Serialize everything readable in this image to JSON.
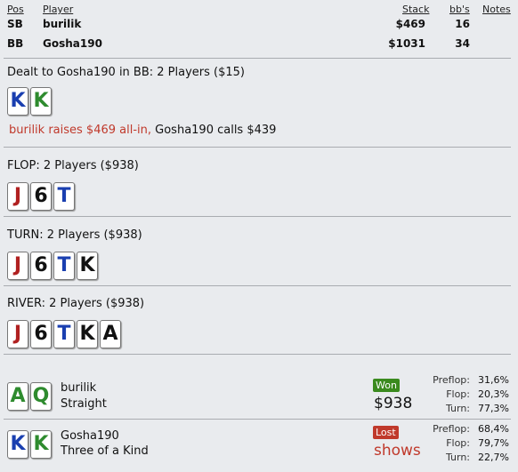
{
  "header": {
    "cols": {
      "pos": "Pos",
      "player": "Player",
      "stack": "Stack",
      "bbs": "bb's",
      "notes": "Notes"
    },
    "rows": [
      {
        "pos": "SB",
        "player": "burilik",
        "stack": "$469",
        "bbs": "16"
      },
      {
        "pos": "BB",
        "player": "Gosha190",
        "stack": "$1031",
        "bbs": "34"
      }
    ]
  },
  "preflop": {
    "title": "Dealt to Gosha190 in BB: 2 Players ($15)",
    "cards": [
      {
        "rank": "K",
        "color": "#1a3fb0"
      },
      {
        "rank": "K",
        "color": "#2e8b2e"
      }
    ],
    "action_red": "burilik raises $469 all-in,",
    "action_black": " Gosha190 calls $439"
  },
  "flop": {
    "title": "FLOP: 2 Players ($938)",
    "cards": [
      {
        "rank": "J",
        "color": "#b02020"
      },
      {
        "rank": "6",
        "color": "#111111"
      },
      {
        "rank": "T",
        "color": "#1a3fb0"
      }
    ]
  },
  "turn": {
    "title": "TURN: 2 Players ($938)",
    "cards": [
      {
        "rank": "J",
        "color": "#b02020"
      },
      {
        "rank": "6",
        "color": "#111111"
      },
      {
        "rank": "T",
        "color": "#1a3fb0"
      },
      {
        "rank": "K",
        "color": "#111111"
      }
    ]
  },
  "river": {
    "title": "RIVER: 2 Players ($938)",
    "cards": [
      {
        "rank": "J",
        "color": "#b02020"
      },
      {
        "rank": "6",
        "color": "#111111"
      },
      {
        "rank": "T",
        "color": "#1a3fb0"
      },
      {
        "rank": "K",
        "color": "#111111"
      },
      {
        "rank": "A",
        "color": "#111111"
      }
    ]
  },
  "results": [
    {
      "name": "burilik",
      "hand": "Straight",
      "cards": [
        {
          "rank": "A",
          "color": "#2e8b2e"
        },
        {
          "rank": "Q",
          "color": "#2e8b2e"
        }
      ],
      "badge": "Won",
      "badge_color": "#3a8a1e",
      "amount": "$938",
      "amount_color": "#111111",
      "stats": [
        {
          "label": "Preflop:",
          "value": "31,6%"
        },
        {
          "label": "Flop:",
          "value": "20,3%"
        },
        {
          "label": "Turn:",
          "value": "77,3%"
        }
      ]
    },
    {
      "name": "Gosha190",
      "hand": "Three of a Kind",
      "cards": [
        {
          "rank": "K",
          "color": "#1a3fb0"
        },
        {
          "rank": "K",
          "color": "#2e8b2e"
        }
      ],
      "badge": "Lost",
      "badge_color": "#c0392b",
      "amount": "shows",
      "amount_color": "#c0392b",
      "stats": [
        {
          "label": "Preflop:",
          "value": "68,4%"
        },
        {
          "label": "Flop:",
          "value": "79,7%"
        },
        {
          "label": "Turn:",
          "value": "22,7%"
        }
      ]
    }
  ]
}
